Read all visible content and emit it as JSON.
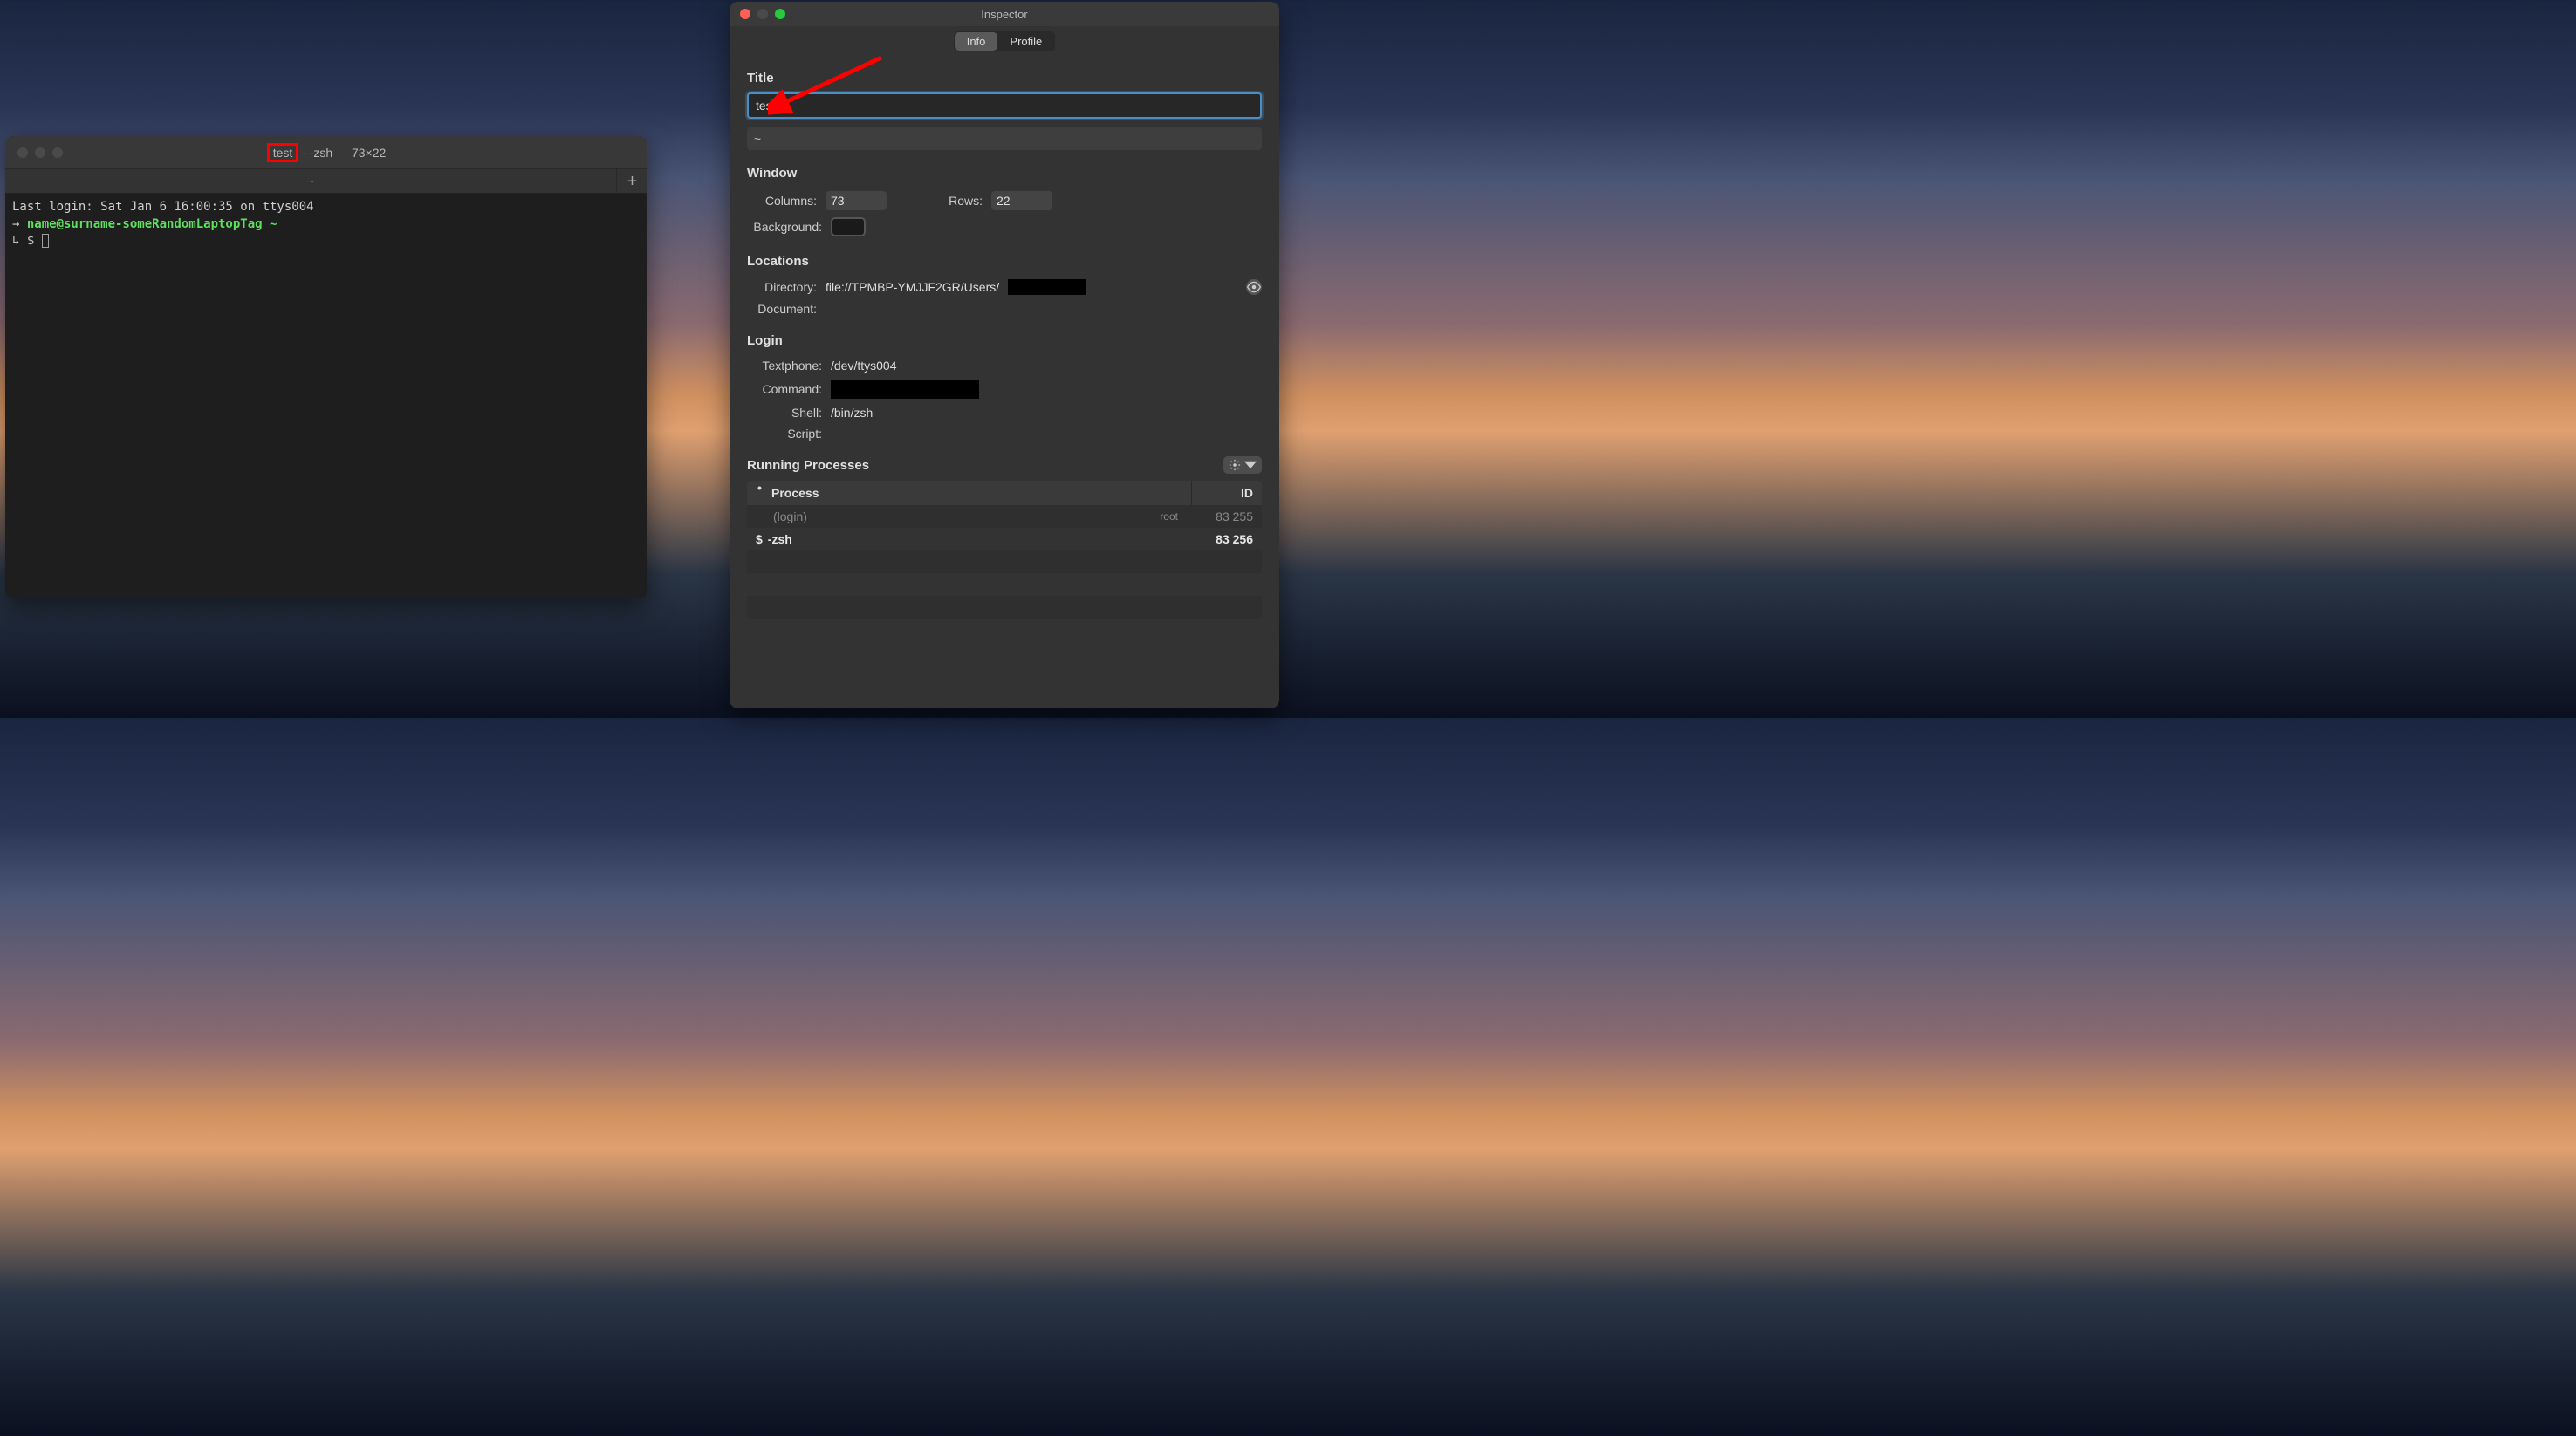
{
  "terminal": {
    "title_highlighted": "test",
    "title_rest": "- -zsh — 73×22",
    "tab_label": "~",
    "last_login": "Last login: Sat Jan  6 16:00:35 on ttys004",
    "prompt_user": "name@surname-someRandomLaptopTag",
    "prompt_path": "~",
    "prompt_symbol": "$"
  },
  "inspector": {
    "window_title": "Inspector",
    "tabs": {
      "info": "Info",
      "profile": "Profile"
    },
    "title_section": {
      "label": "Title",
      "value": "test",
      "secondary": "~"
    },
    "window_section": {
      "label": "Window",
      "columns_label": "Columns:",
      "columns_value": "73",
      "rows_label": "Rows:",
      "rows_value": "22",
      "background_label": "Background:"
    },
    "locations_section": {
      "label": "Locations",
      "directory_label": "Directory:",
      "directory_value": "file://TPMBP-YMJJF2GR/Users/",
      "document_label": "Document:"
    },
    "login_section": {
      "label": "Login",
      "textphone_label": "Textphone:",
      "textphone_value": "/dev/ttys004",
      "command_label": "Command:",
      "shell_label": "Shell:",
      "shell_value": "/bin/zsh",
      "script_label": "Script:"
    },
    "processes_section": {
      "label": "Running Processes",
      "col_process": "Process",
      "col_id": "ID",
      "rows": [
        {
          "name": "(login)",
          "owner": "root",
          "id": "83 255",
          "dim": true
        },
        {
          "name": "-zsh",
          "prefix": "$",
          "id": "83 256",
          "bold": true
        }
      ]
    }
  }
}
